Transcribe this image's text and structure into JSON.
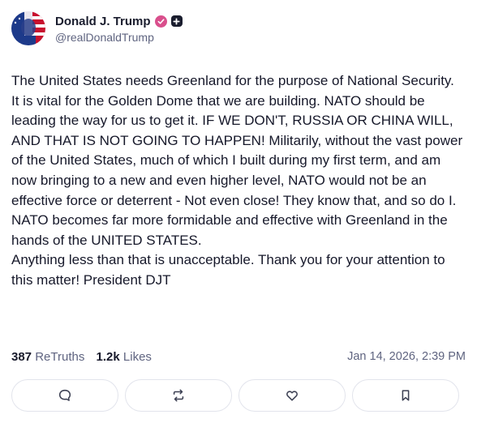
{
  "author": {
    "display_name": "Donald J. Trump",
    "handle": "@realDonaldTrump"
  },
  "post": {
    "text": "The United States needs Greenland for the purpose of National Security. It is vital for the Golden Dome that we are building. NATO should be leading the way for us to get it. IF WE DON'T, RUSSIA OR CHINA WILL, AND THAT IS NOT GOING TO HAPPEN! Militarily, without the vast power of the United States, much of which I built during my first term, and am now bringing to a new and even higher level, NATO would not be an effective force or deterrent - Not even close! They know that, and so do I. NATO becomes far more formidable and effective with Greenland in the hands of the UNITED STATES.\nAnything less than that is unacceptable. Thank you for your attention to this matter! President DJT"
  },
  "stats": {
    "retruths_count": "387",
    "retruths_label": "ReTruths",
    "likes_count": "1.2k",
    "likes_label": "Likes",
    "timestamp": "Jan 14, 2026, 2:39 PM"
  },
  "actions": [
    {
      "icon": "reply-icon"
    },
    {
      "icon": "retruth-icon"
    },
    {
      "icon": "like-icon"
    },
    {
      "icon": "bookmark-icon"
    }
  ],
  "colors": {
    "verified_badge": "#d94f8c",
    "muted_text": "#5f6480",
    "border": "#e2e4ec"
  }
}
